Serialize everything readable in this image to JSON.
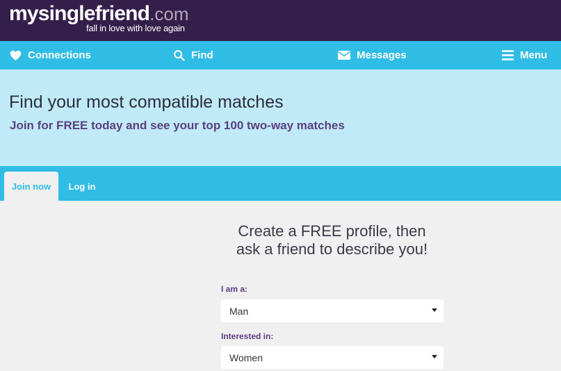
{
  "brand": {
    "name": "mysinglefriend",
    "domain_suffix": ".com",
    "tagline": "fall in love with love again"
  },
  "nav": {
    "items": [
      {
        "label": "Connections",
        "icon": "heart-icon"
      },
      {
        "label": "Find",
        "icon": "search-icon"
      },
      {
        "label": "Messages",
        "icon": "envelope-icon"
      },
      {
        "label": "Menu",
        "icon": "hamburger-icon"
      }
    ]
  },
  "hero": {
    "title": "Find your most compatible matches",
    "subtitle": "Join for FREE today and see your top 100 two-way matches"
  },
  "tabs": [
    {
      "label": "Join now",
      "active": true
    },
    {
      "label": "Log in",
      "active": false
    }
  ],
  "form": {
    "title_line1": "Create a FREE profile, then",
    "title_line2": "ask a friend to describe you!",
    "i_am_label": "I am a:",
    "i_am_value": "Man",
    "interested_label": "Interested in:",
    "interested_value": "Women"
  },
  "colors": {
    "header_bg": "#341e4a",
    "nav_bg": "#2fbde6",
    "hero_bg": "#c0eaf7",
    "accent_purple": "#5b3f80",
    "page_bg": "#f0f0f0"
  }
}
